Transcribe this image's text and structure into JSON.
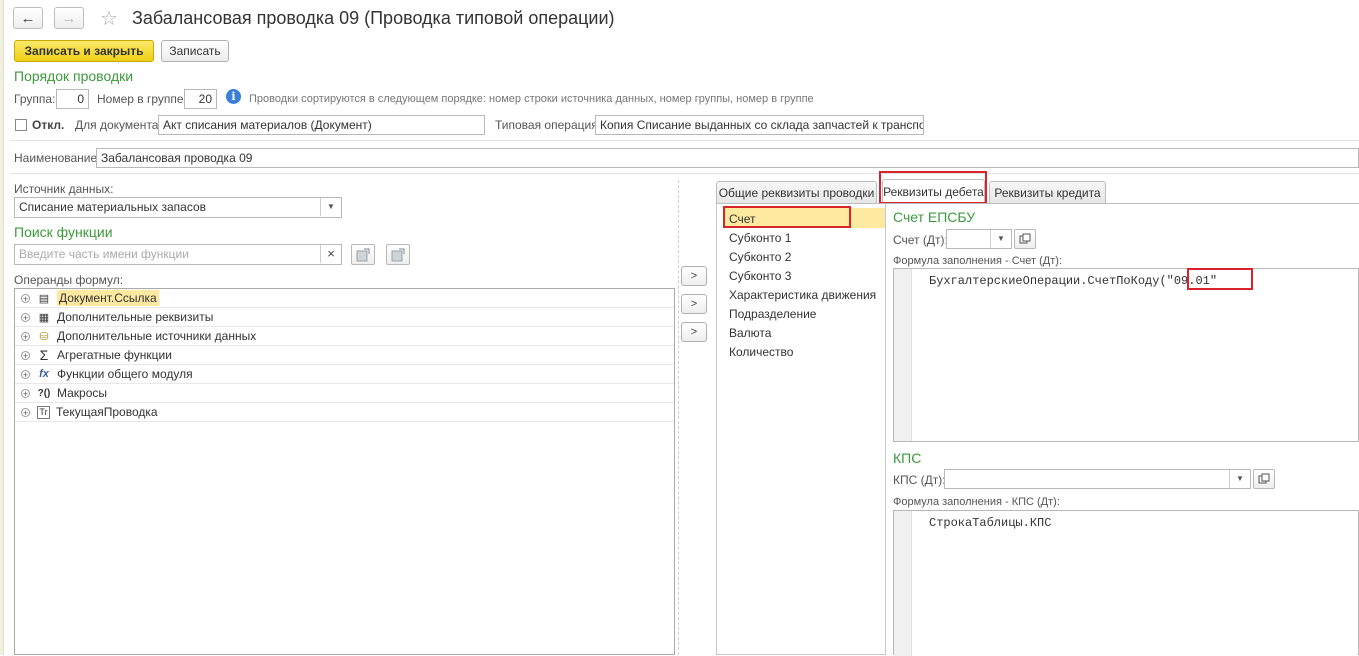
{
  "window": {
    "title": "Забалансовая проводка 09 (Проводка типовой операции)",
    "back_icon": "arrow-left",
    "forward_icon": "arrow-right",
    "favorite_icon": "star-outline"
  },
  "toolbar": {
    "save_close_label": "Записать и закрыть",
    "save_label": "Записать"
  },
  "order": {
    "section_title": "Порядок проводки",
    "group_label": "Группа:",
    "group_value": "0",
    "group_number_label": "Номер в группе:",
    "group_number_value": "20",
    "hint": "Проводки сортируются в следующем порядке: номер строки источника данных, номер группы,  номер в группе"
  },
  "doc_row": {
    "disabled_label": "Откл.",
    "document_label": "Для документа:",
    "document_value": "Акт списания материалов (Документ)",
    "operation_label": "Типовая операция:",
    "operation_value": "Копия Списание выданных со склада запчастей к транспорту ("
  },
  "name_row": {
    "label": "Наименование:",
    "value": "Забалансовая проводка 09"
  },
  "left_panel": {
    "source_label": "Источник данных:",
    "source_value": "Списание материальных запасов",
    "search_title": "Поиск функции",
    "search_placeholder": "Введите часть имени функции",
    "clear_symbol": "×",
    "operands_label": "Операнды формул:",
    "tree_items": [
      {
        "label": "Документ.Ссылка",
        "icon": "document-icon",
        "icon_glyph": "▤",
        "selected": true
      },
      {
        "label": "Дополнительные реквизиты",
        "icon": "table-icon",
        "icon_glyph": "▦",
        "selected": false
      },
      {
        "label": "Дополнительные источники данных",
        "icon": "data-source-icon",
        "icon_glyph": "⛁",
        "selected": false
      },
      {
        "label": "Агрегатные функции",
        "icon": "sigma-icon",
        "icon_glyph": "Σ",
        "selected": false
      },
      {
        "label": "Функции общего модуля",
        "icon": "function-icon",
        "icon_glyph": "fx",
        "selected": false
      },
      {
        "label": "Макросы",
        "icon": "macro-icon",
        "icon_glyph": "?()",
        "selected": false
      },
      {
        "label": "ТекущаяПроводка",
        "icon": "entry-icon",
        "icon_glyph": "Tr",
        "selected": false
      }
    ],
    "plus_symbol": "+"
  },
  "arrow_symbol": ">",
  "tabs": [
    {
      "label": "Общие реквизиты проводки",
      "active": false
    },
    {
      "label": "Реквизиты дебета",
      "active": true
    },
    {
      "label": "Реквизиты кредита",
      "active": false
    }
  ],
  "debit_list": [
    "Счет",
    "Субконто 1",
    "Субконто 2",
    "Субконто 3",
    "Характеристика движения",
    "Подразделение",
    "Валюта",
    "Количество"
  ],
  "account_section": {
    "title": "Счет ЕПСБУ",
    "account_label": "Счет (Дт):",
    "account_value": "",
    "formula_label": "Формула заполнения - Счет (Дт):",
    "formula_prefix": "БухгалтерскиеОперации.СчетПоКоду(",
    "formula_arg": "\"09.01\""
  },
  "kps_section": {
    "title": "КПС",
    "kps_label": "КПС (Дт):",
    "kps_value": "",
    "formula_label": "Формула заполнения - КПС (Дт):",
    "formula": "СтрокаТаблицы.КПС"
  },
  "colors": {
    "accent_green": "#3c9a3c",
    "primary_button": "#f2d31b",
    "selection": "#fde9a0",
    "highlight_box": "#d9232a"
  }
}
